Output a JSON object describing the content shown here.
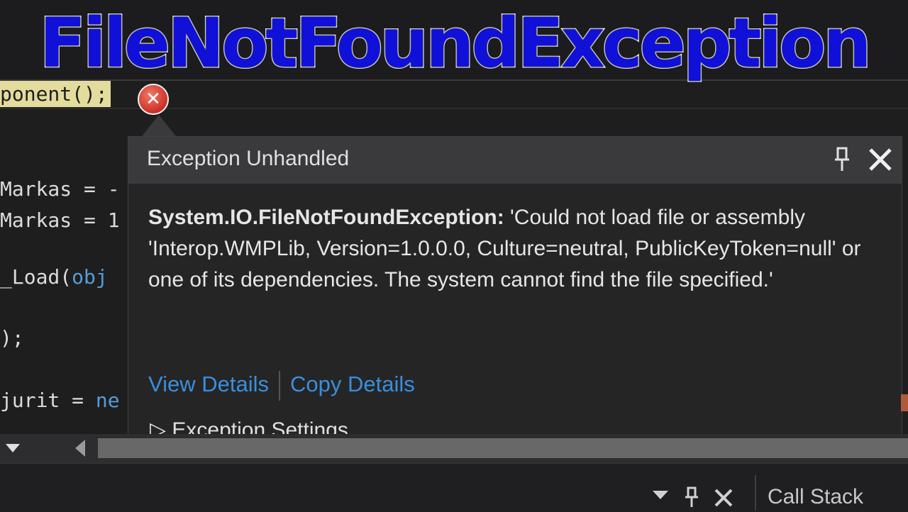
{
  "banner": {
    "title": "FileNotFoundException"
  },
  "code": {
    "lines": [
      {
        "text": "ponent();"
      },
      {
        "text": "Markas = -"
      },
      {
        "text": "Markas = 1"
      },
      {
        "pre": "_Load(",
        "kw": "obj"
      },
      {
        "text": ");"
      },
      {
        "pre": "jurit = ",
        "kw": "ne"
      }
    ]
  },
  "exception_popup": {
    "title": "Exception Unhandled",
    "exception_type": "System.IO.FileNotFoundException:",
    "message": " 'Could not load file or assembly 'Interop.WMPLib, Version=1.0.0.0, Culture=neutral, PublicKeyToken=null' or one of its dependencies. The system cannot find the file specified.'",
    "view_details": "View Details",
    "copy_details": "Copy Details",
    "settings_label": "Exception Settings",
    "pin_icon": "pin-icon",
    "close_icon": "close-icon"
  },
  "bottom_panel": {
    "call_stack_tab": "Call Stack"
  },
  "colors": {
    "banner_text": "#1010d8",
    "link": "#3b8edb",
    "error_icon": "#d0342a",
    "highlight": "#e3dc9c"
  }
}
